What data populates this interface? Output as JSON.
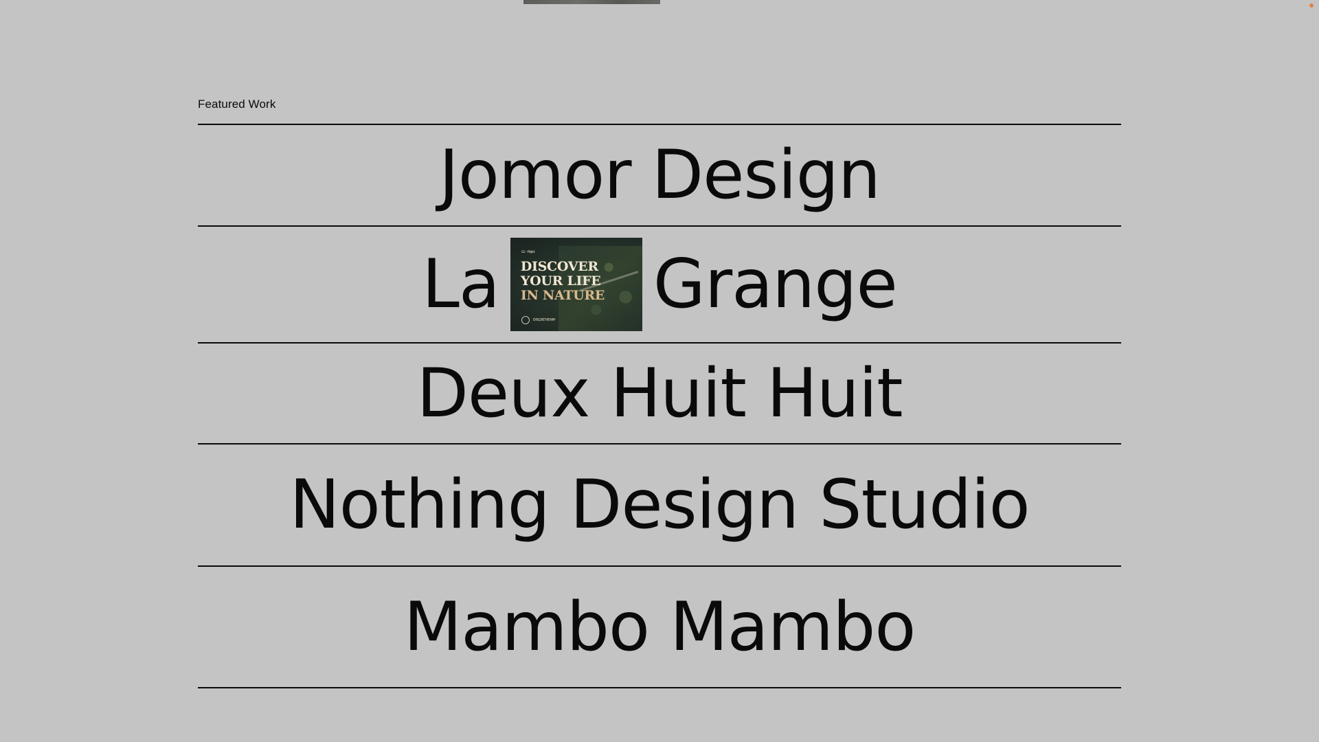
{
  "section": {
    "label": "Featured Work"
  },
  "works": [
    {
      "title": "Jomor Design"
    },
    {
      "title_before": "La",
      "title_after": "Grange",
      "preview": {
        "nav": "LG  ·  ·  ·  Project",
        "headline_line1": "DISCOVER",
        "headline_line2": "YOUR LIFE",
        "headline_line3": "IN NATURE",
        "cta": "EXPLORE THE MAP"
      }
    },
    {
      "title": "Deux Huit Huit"
    },
    {
      "title": "Nothing Design Studio"
    },
    {
      "title": "Mambo Mambo"
    }
  ],
  "colors": {
    "background": "#c4c4c4",
    "text": "#0a0a0a",
    "accent_dot": "#e0804a"
  }
}
